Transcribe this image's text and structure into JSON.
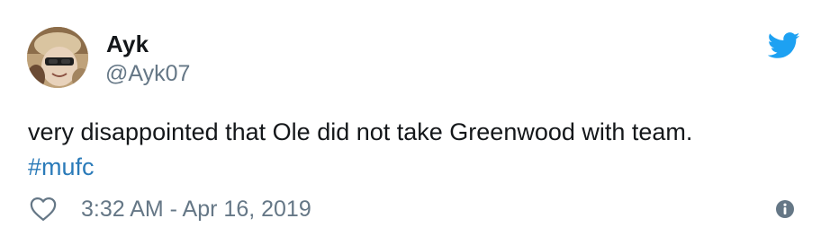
{
  "author": {
    "name": "Ayk",
    "handle": "@Ayk07",
    "avatar_icon": "user-avatar-photo"
  },
  "tweet": {
    "text": "very disappointed that Ole did not take Greenwood with team.",
    "hashtag": "#mufc",
    "timestamp": "3:32 AM - Apr 16, 2019"
  },
  "icons": {
    "brand": "twitter-bird-icon",
    "like": "heart-icon",
    "info": "info-icon"
  },
  "colors": {
    "text": "#14171a",
    "muted": "#657786",
    "link": "#2b7bb9",
    "twitter_blue": "#1da1f2",
    "icon_gray": "#657786"
  }
}
